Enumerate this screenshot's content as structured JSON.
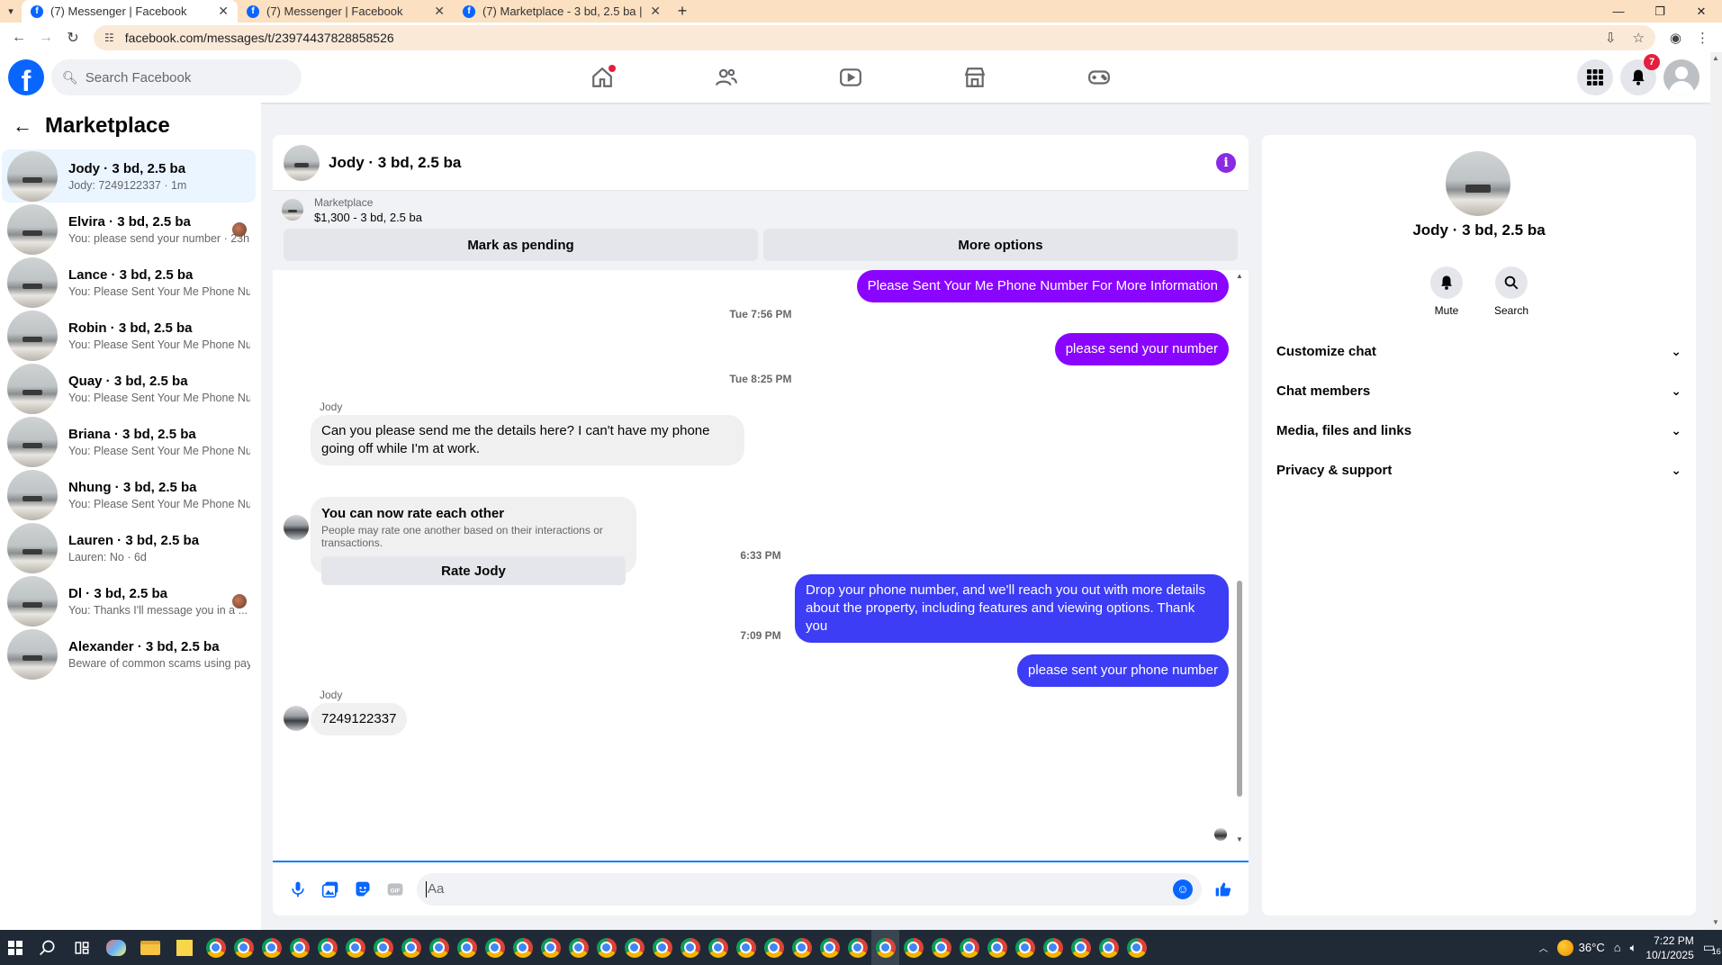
{
  "browser": {
    "tabs": [
      {
        "title": "(7) Messenger | Facebook",
        "active": true
      },
      {
        "title": "(7) Messenger | Facebook",
        "active": false
      },
      {
        "title": "(7) Marketplace - 3 bd, 2.5 ba |",
        "active": false
      }
    ],
    "url": "facebook.com/messages/t/23974437828858526"
  },
  "fb": {
    "search_placeholder": "Search Facebook",
    "notification_count": "7"
  },
  "sidebar": {
    "title": "Marketplace",
    "conversations": [
      {
        "name": "Jody · 3 bd, 2.5 ba",
        "preview": "Jody: 7249122337 · 1m",
        "active": true,
        "seen": false
      },
      {
        "name": "Elvira · 3 bd, 2.5 ba",
        "preview": "You: please send your number · 23h",
        "active": false,
        "seen": true
      },
      {
        "name": "Lance · 3 bd, 2.5 ba",
        "preview": "You: Please Sent Your Me Phone Num... · 2d",
        "active": false,
        "seen": false
      },
      {
        "name": "Robin · 3 bd, 2.5 ba",
        "preview": "You: Please Sent Your Me Phone Num... · 2d",
        "active": false,
        "seen": false
      },
      {
        "name": "Quay · 3 bd, 2.5 ba",
        "preview": "You: Please Sent Your Me Phone Num... · 2d",
        "active": false,
        "seen": false
      },
      {
        "name": "Briana · 3 bd, 2.5 ba",
        "preview": "You: Please Sent Your Me Phone Num... · 2d",
        "active": false,
        "seen": false
      },
      {
        "name": "Nhung · 3 bd, 2.5 ba",
        "preview": "You: Please Sent Your Me Phone Num... · 2d",
        "active": false,
        "seen": false
      },
      {
        "name": "Lauren · 3 bd, 2.5 ba",
        "preview": "Lauren: No · 6d",
        "active": false,
        "seen": false
      },
      {
        "name": "Dl · 3 bd, 2.5 ba",
        "preview": "You: Thanks I'll message you in a ... · 6d",
        "active": false,
        "seen": true
      },
      {
        "name": "Alexander · 3 bd, 2.5 ba",
        "preview": "Beware of common scams using pay... · 6d",
        "active": false,
        "seen": false
      }
    ]
  },
  "chat": {
    "title": "Jody · 3 bd, 2.5 ba",
    "listing_label": "Marketplace",
    "listing_price": "$1,300 - 3 bd, 2.5 ba",
    "mark_pending": "Mark as pending",
    "more_options": "More options",
    "messages": {
      "m1": "Please Sent Your Me Phone Number For More Information",
      "t1": "Tue 7:56 PM",
      "m2": "please send your number",
      "t2": "Tue 8:25 PM",
      "sender1": "Jody",
      "m3": "Can you please send me the details here? I can't have my phone going off while I'm at work.",
      "rate_title": "You can now rate each other",
      "rate_sub": "People may rate one another based on their interactions or transactions.",
      "rate_button": "Rate Jody",
      "t3": "6:33 PM",
      "m4": "Drop your phone number, and we'll reach you out with more details about the property, including features and viewing options.  Thank you",
      "t4": "7:09 PM",
      "m5": "please sent your phone number",
      "sender2": "Jody",
      "m6": "7249122337"
    },
    "composer_placeholder": "Aa"
  },
  "rpanel": {
    "name": "Jody · 3 bd, 2.5 ba",
    "mute": "Mute",
    "search": "Search",
    "sections": [
      "Customize chat",
      "Chat members",
      "Media, files and links",
      "Privacy & support"
    ]
  },
  "taskbar": {
    "temperature": "36°C",
    "time": "7:22 PM",
    "date": "10/1/2025",
    "notif_count": "16"
  }
}
